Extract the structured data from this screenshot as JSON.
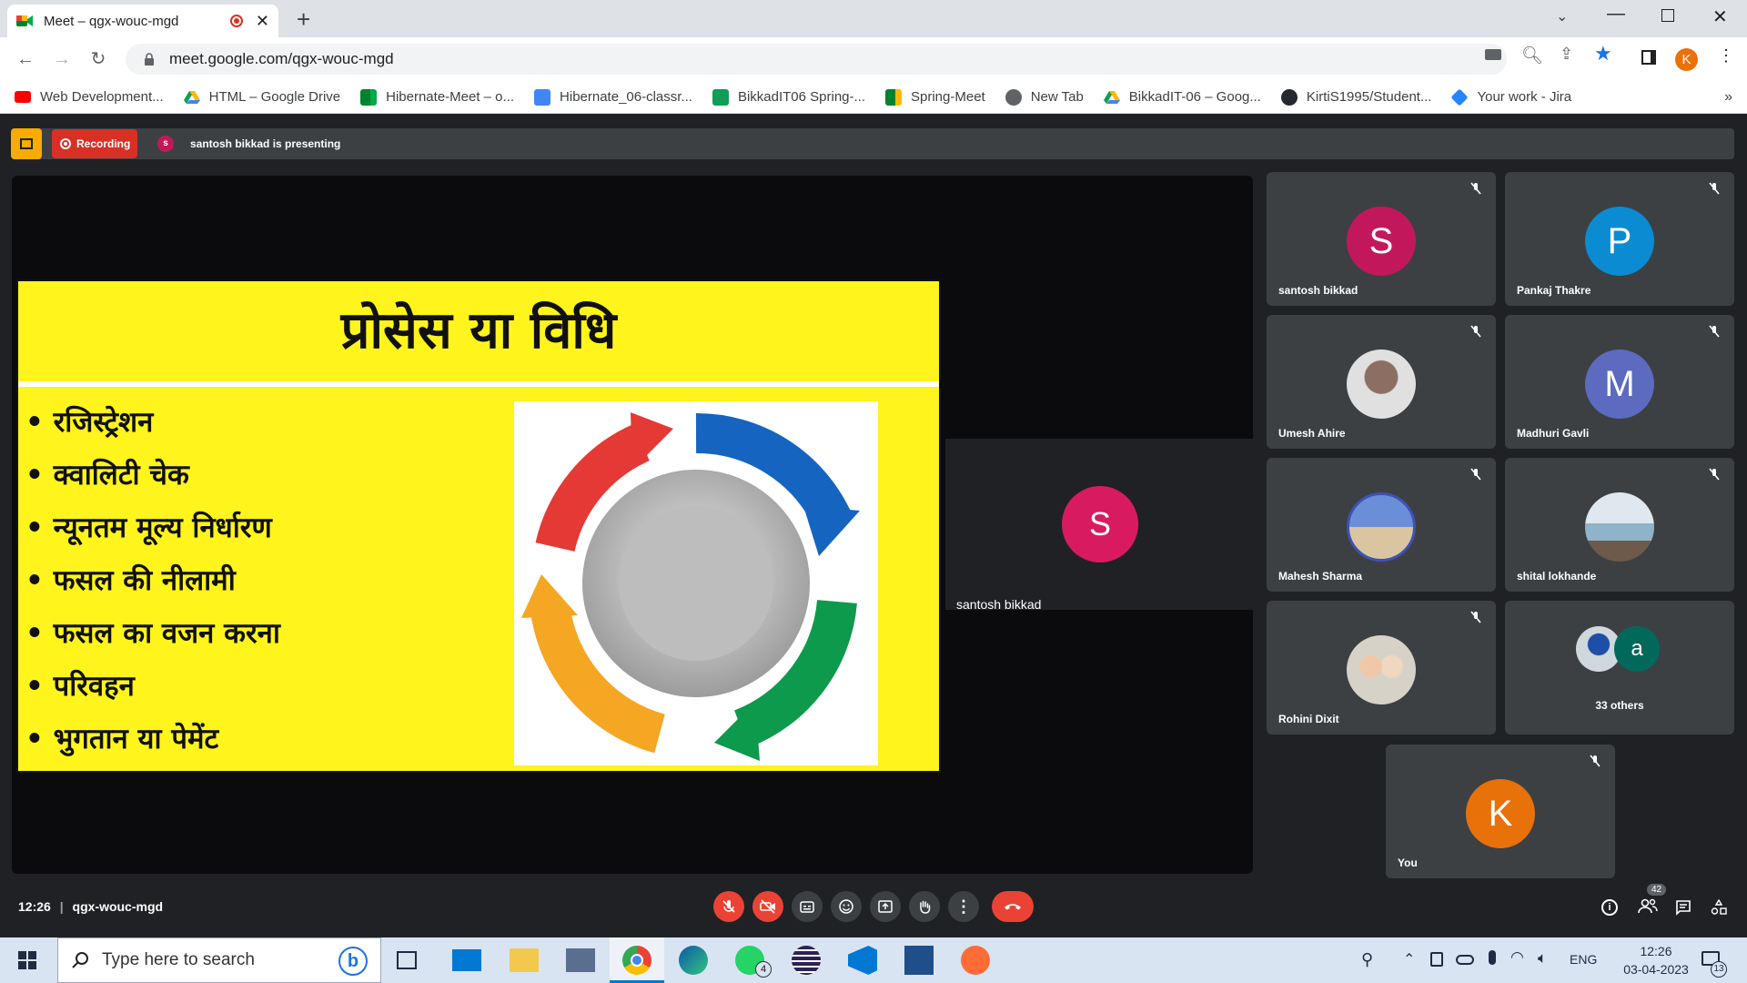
{
  "browser": {
    "tab_title": "Meet – qgx-wouc-mgd",
    "url": "meet.google.com/qgx-wouc-mgd",
    "profile_initial": "K",
    "bookmarks": [
      "Web Development...",
      "HTML – Google Drive",
      "Hibernate-Meet – o...",
      "Hibernate_06-classr...",
      "BikkadIT06 Spring-...",
      "Spring-Meet",
      "New Tab",
      "BikkadIT-06 – Goog...",
      "KirtiS1995/Student...",
      "Your work - Jira"
    ]
  },
  "meet": {
    "recording_label": "Recording",
    "presenter_initial": "s",
    "presenting_text": "santosh bikkad is presenting",
    "presenter_tile": {
      "initial": "S",
      "name": "santosh bikkad"
    },
    "slide": {
      "title": "प्रोसेस या विधि",
      "bullets": [
        "रजिस्ट्रेशन",
        "क्वालिटी चेक",
        "न्यूनतम मूल्य निर्धारण",
        "फसल की नीलामी",
        "फसल का वजन करना",
        "परिवहन",
        "भुगतान या पेमेंट"
      ]
    },
    "participants": [
      {
        "name": "santosh bikkad",
        "initial": "S",
        "color": "#c2185b"
      },
      {
        "name": "Pankaj Thakre",
        "initial": "P",
        "color": "#0b8bd1"
      },
      {
        "name": "Umesh Ahire",
        "initial": "",
        "color": "#e0e0e0"
      },
      {
        "name": "Madhuri Gavli",
        "initial": "M",
        "color": "#5c6bc0"
      },
      {
        "name": "Mahesh Sharma",
        "initial": "",
        "color": "#6a8fd8"
      },
      {
        "name": "shital lokhande",
        "initial": "",
        "color": "#8fb3c8"
      },
      {
        "name": "Rohini Dixit",
        "initial": "",
        "color": "#d7d2c8"
      }
    ],
    "others": {
      "initial": "a",
      "label": "33 others"
    },
    "self": {
      "name": "You",
      "initial": "K"
    },
    "bottom": {
      "time": "12:26",
      "meeting_code": "qgx-wouc-mgd",
      "people_count": "42"
    }
  },
  "taskbar": {
    "search_placeholder": "Type here to search",
    "whatsapp_badge": "4",
    "language": "ENG",
    "time": "12:26",
    "date": "03-04-2023",
    "notification_count": "13"
  },
  "colors": {
    "accent_red": "#ea4335",
    "meet_bg": "#202124",
    "tile_bg": "#3c4043",
    "slide_yellow": "#fff41b"
  }
}
